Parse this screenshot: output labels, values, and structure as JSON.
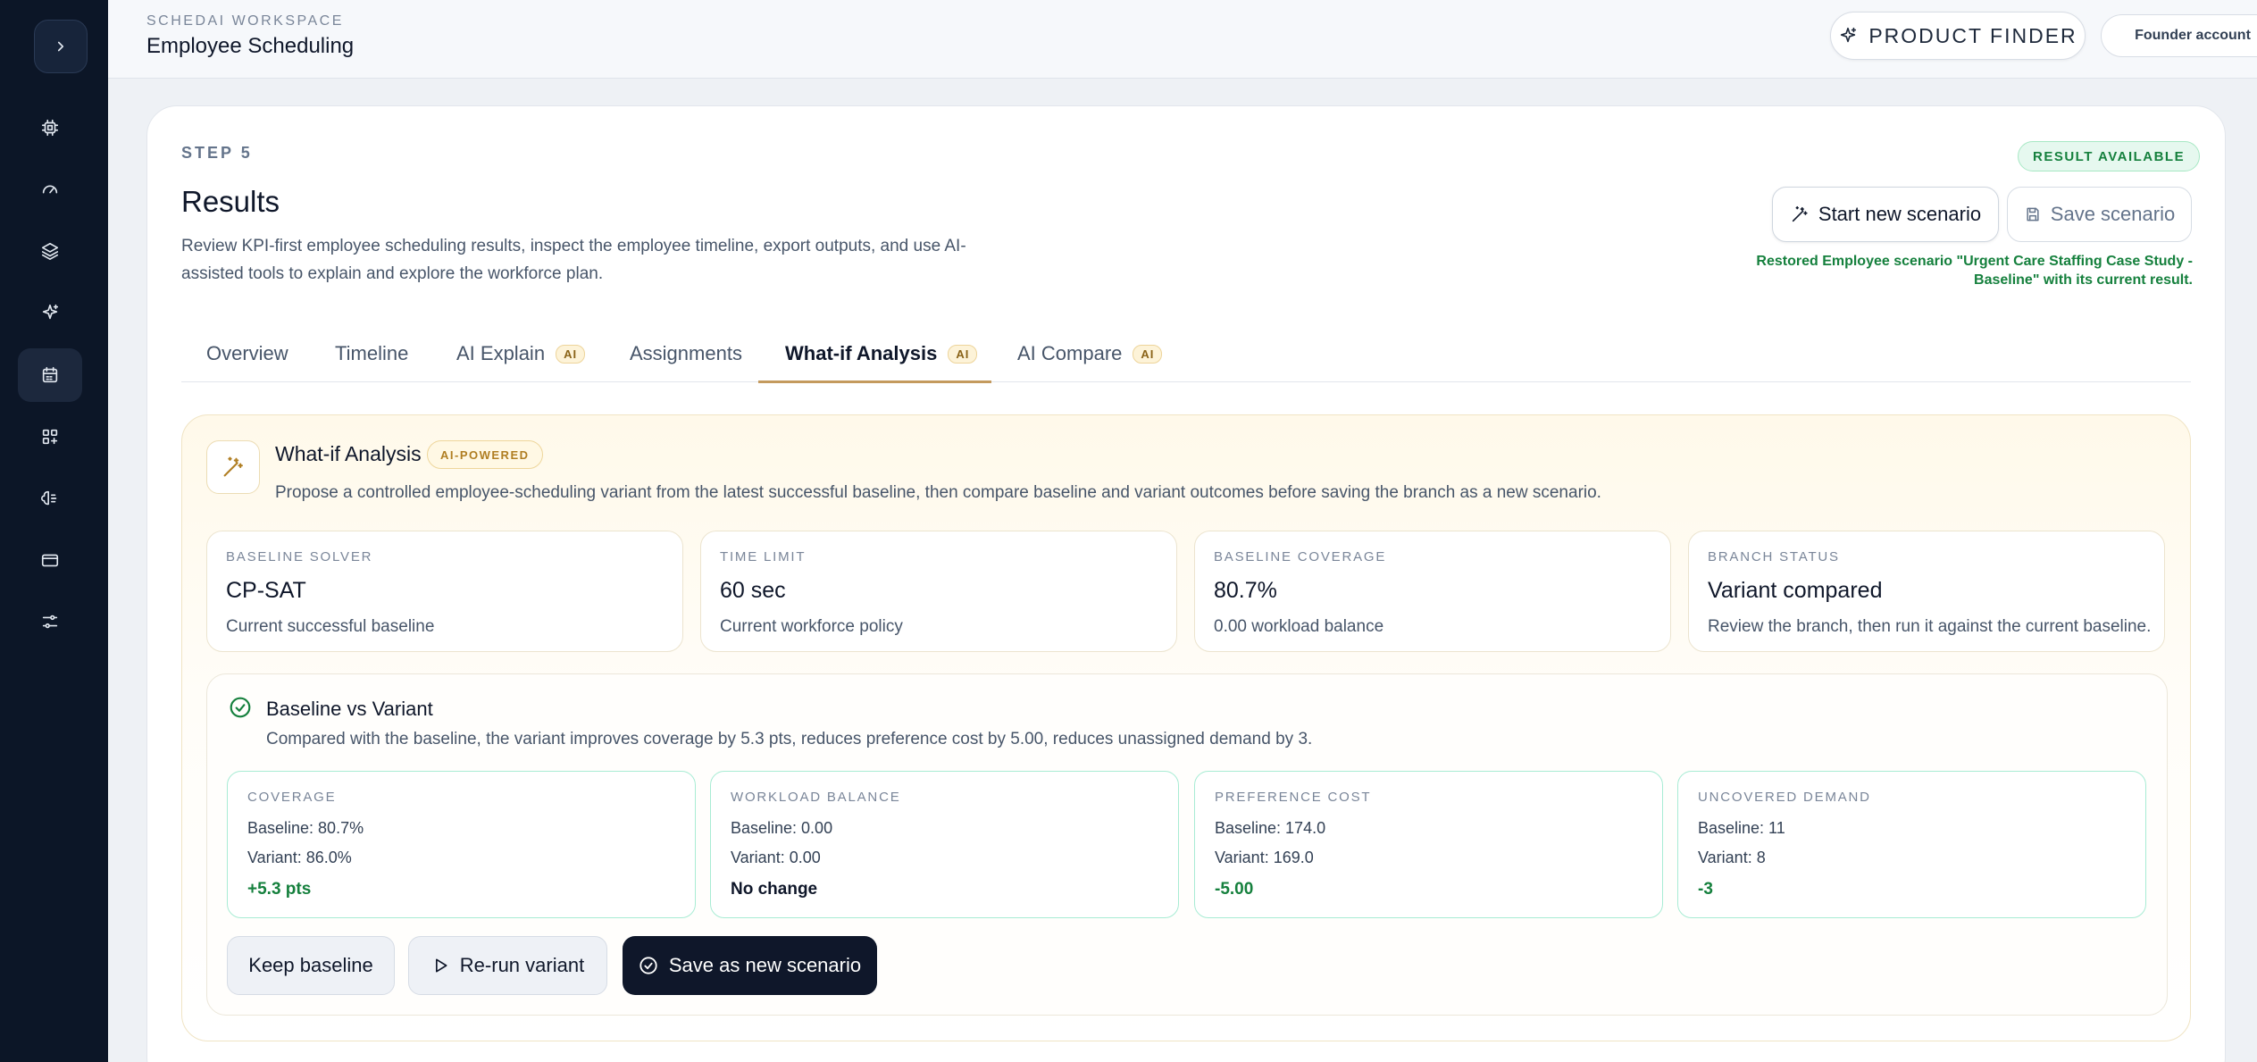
{
  "sidebar": {
    "toggle_icon": "chevron-right-icon",
    "items": [
      {
        "icon": "cpu-icon",
        "active": false
      },
      {
        "icon": "gauge-icon",
        "active": false
      },
      {
        "icon": "layers-icon",
        "active": false
      },
      {
        "icon": "sparkles-icon",
        "active": false
      },
      {
        "icon": "calendar-icon",
        "active": true
      },
      {
        "icon": "grid-plus-icon",
        "active": false
      },
      {
        "icon": "brain-icon",
        "active": false
      },
      {
        "icon": "credit-card-icon",
        "active": false
      },
      {
        "icon": "sliders-icon",
        "active": false
      }
    ]
  },
  "header": {
    "workspace_label": "SCHEDAI WORKSPACE",
    "page_title": "Employee Scheduling",
    "product_finder": "PRODUCT FINDER",
    "account": "Founder account"
  },
  "results": {
    "step": "STEP 5",
    "title": "Results",
    "description": "Review KPI-first employee scheduling results, inspect the employee timeline, export outputs, and use AI-assisted tools to explain and explore the workforce plan.",
    "badge": "RESULT AVAILABLE",
    "start_button": "Start new scenario",
    "save_button": "Save scenario",
    "restored_message": "Restored Employee scenario \"Urgent Care Staffing Case Study - Baseline\" with its current result."
  },
  "tabs": [
    {
      "label": "Overview",
      "ai": ""
    },
    {
      "label": "Timeline",
      "ai": ""
    },
    {
      "label": "AI Explain",
      "ai": "AI"
    },
    {
      "label": "Assignments",
      "ai": ""
    },
    {
      "label": "What-if Analysis",
      "ai": "AI",
      "active": true
    },
    {
      "label": "AI Compare",
      "ai": "AI"
    }
  ],
  "whatif": {
    "title": "What-if Analysis",
    "badge": "AI-POWERED",
    "description": "Propose a controlled employee-scheduling variant from the latest successful baseline, then compare baseline and variant outcomes before saving the branch as a new scenario.",
    "stats": [
      {
        "label": "BASELINE SOLVER",
        "value": "CP-SAT",
        "sub": "Current successful baseline"
      },
      {
        "label": "TIME LIMIT",
        "value": "60 sec",
        "sub": "Current workforce policy"
      },
      {
        "label": "BASELINE COVERAGE",
        "value": "80.7%",
        "sub": "0.00 workload balance"
      },
      {
        "label": "BRANCH STATUS",
        "value": "Variant compared",
        "sub": "Review the branch, then run it against the current baseline."
      }
    ],
    "compare": {
      "title": "Baseline vs Variant",
      "description": "Compared with the baseline, the variant improves coverage by 5.3 pts, reduces preference cost by 5.00, reduces unassigned demand by 3.",
      "metrics": [
        {
          "label": "COVERAGE",
          "baseline": "Baseline: 80.7%",
          "variant": "Variant: 86.0%",
          "delta": "+5.3 pts",
          "tone": "pos"
        },
        {
          "label": "WORKLOAD BALANCE",
          "baseline": "Baseline: 0.00",
          "variant": "Variant: 0.00",
          "delta": "No change",
          "tone": "neu"
        },
        {
          "label": "PREFERENCE COST",
          "baseline": "Baseline: 174.0",
          "variant": "Variant: 169.0",
          "delta": "-5.00",
          "tone": "pos"
        },
        {
          "label": "UNCOVERED DEMAND",
          "baseline": "Baseline: 11",
          "variant": "Variant: 8",
          "delta": "-3",
          "tone": "pos"
        }
      ],
      "actions": {
        "keep": "Keep baseline",
        "rerun": "Re-run variant",
        "save": "Save as new scenario"
      }
    }
  },
  "colors": {
    "sidebar_bg": "#0c1627",
    "accent_green": "#15803d",
    "ai_gold": "#b07e22",
    "primary_dark": "#0f172a"
  }
}
